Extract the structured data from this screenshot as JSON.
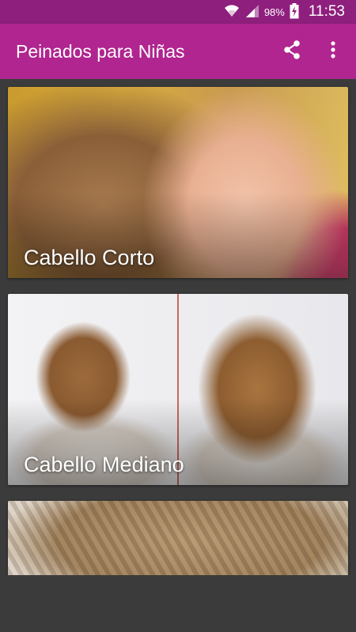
{
  "status_bar": {
    "battery_percent": "98%",
    "time": "11:53",
    "icons": [
      "wifi-icon",
      "cellular-signal-icon",
      "battery-charging-icon"
    ]
  },
  "app_bar": {
    "title": "Peinados para Niñas",
    "actions": [
      "share-icon",
      "overflow-menu-icon"
    ]
  },
  "colors": {
    "status_bar": "#8e1f7d",
    "app_bar": "#b0258f",
    "background": "#3b3b3b",
    "label_text": "#ffffff"
  },
  "cards": [
    {
      "label": "Cabello Corto"
    },
    {
      "label": "Cabello Mediano"
    },
    {
      "label": ""
    }
  ]
}
